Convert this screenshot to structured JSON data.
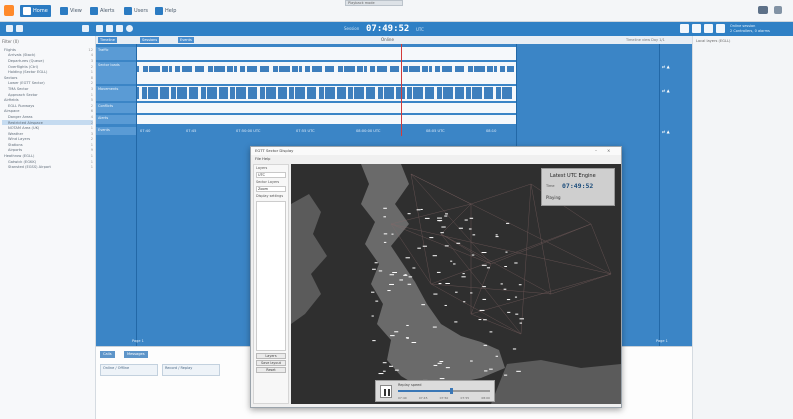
{
  "menubar": {
    "tabs": [
      {
        "label": "Home",
        "icon": "home-icon"
      },
      {
        "label": "View",
        "icon": "view-icon"
      },
      {
        "label": "Alerts",
        "icon": "alerts-icon"
      },
      {
        "label": "Users",
        "icon": "users-icon"
      },
      {
        "label": "Help",
        "icon": "help-icon"
      }
    ],
    "tooltip": "Playback mode"
  },
  "header": {
    "time_label": "Session",
    "time": "07:49:52",
    "time_unit": "UTC",
    "status_line1": "Online session",
    "status_line2": "2 Controllers, 0 alarms"
  },
  "left_panel": {
    "header": "Filter (0)",
    "items": [
      {
        "label": "Flights",
        "count": "12"
      },
      {
        "label": "Arrivals (Stack)",
        "count": "4"
      },
      {
        "label": "Departures (Queue)",
        "count": "3"
      },
      {
        "label": "Overflights (Ctrl)",
        "count": "2"
      },
      {
        "label": "Holding (Sector EGLL)",
        "count": "1"
      },
      {
        "label": "Sectors",
        "count": "8"
      },
      {
        "label": "Lower (EGTT Sector)",
        "count": "2"
      },
      {
        "label": "TMA Sector",
        "count": "3"
      },
      {
        "label": "Approach Sector",
        "count": "1"
      },
      {
        "label": "Airfields",
        "count": "5"
      },
      {
        "label": "EGLL Runways",
        "count": "2"
      },
      {
        "label": "Airspace",
        "count": "6"
      },
      {
        "label": "Danger Areas",
        "count": "4"
      },
      {
        "label": "Restricted Airspace",
        "count": "2"
      },
      {
        "label": "NOTAM Area (UK)",
        "count": "1"
      },
      {
        "label": "Weather",
        "count": "3"
      },
      {
        "label": "Wind Layers",
        "count": "2"
      },
      {
        "label": "Stations",
        "count": "1"
      },
      {
        "label": "Airports",
        "count": "9"
      },
      {
        "label": "Heathrow (EGLL)",
        "count": "1"
      },
      {
        "label": "Gatwick (EGKK)",
        "count": "1"
      },
      {
        "label": "Stansted (EGSS) Airport",
        "count": "1"
      }
    ]
  },
  "timeline": {
    "ruler_buttons": [
      "Timeline",
      "Sessions",
      "Events"
    ],
    "ruler_title": "Online",
    "ruler_right": "Timeline view   Day 1/1",
    "tracks": [
      {
        "label": "Traffic",
        "right": ""
      },
      {
        "label": "Sector loads",
        "right": "⇄ ▲"
      },
      {
        "label": "Movements",
        "right": "⇄ ▲"
      },
      {
        "label": "Conflicts",
        "right": ""
      },
      {
        "label": "Alerts",
        "right": ""
      },
      {
        "label": "Events",
        "right": "⇄ ▲"
      }
    ],
    "axis_labels": [
      "07:40",
      "07:45",
      "07:50:00 UTC",
      "07:55 UTC",
      "08:00:00 UTC",
      "08:05 UTC",
      "08:10"
    ],
    "bottom_left": "Page 1",
    "bottom_right": "Page 1"
  },
  "bottom_panel": {
    "tabs": [
      "Calls",
      "Messages"
    ],
    "cards": [
      "Online / Offline",
      "Record / Replay"
    ]
  },
  "right_panel": {
    "label": "Local layers (EGLL)"
  },
  "map_window": {
    "title": "EGTT Sector Display",
    "menu": "File   Help",
    "side_label1": "Layers",
    "side_box1": "UTC",
    "side_label2": "Sector Layers",
    "side_box2": "Zoom",
    "side_label3": "Display settings",
    "side_buttons": [
      "Layers",
      "Save layout",
      "Reset"
    ],
    "info_title": "Latest UTC Engine",
    "info_label": "Time",
    "info_time": "07:49:52",
    "info_sub": "Playing",
    "playback": {
      "title": "Replay speed",
      "progress": 0.58,
      "marks": [
        "07:40",
        "07:45",
        "07:50",
        "07:55",
        "08:00"
      ]
    }
  }
}
